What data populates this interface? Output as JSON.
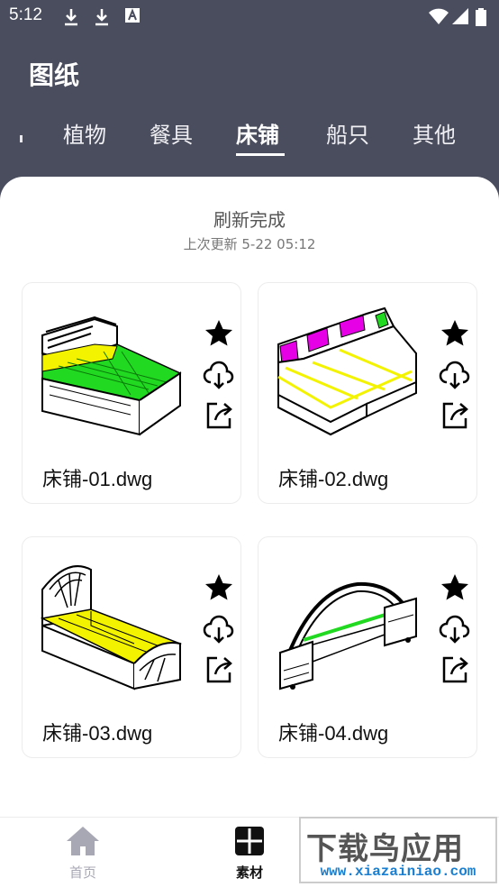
{
  "status": {
    "time": "5:12"
  },
  "app": {
    "title": "图纸"
  },
  "tabs": [
    {
      "label": "植物",
      "active": false
    },
    {
      "label": "餐具",
      "active": false
    },
    {
      "label": "床铺",
      "active": true
    },
    {
      "label": "船只",
      "active": false
    },
    {
      "label": "其他",
      "active": false
    }
  ],
  "refresh": {
    "title": "刷新完成",
    "subtitle": "上次更新 5-22 05:12"
  },
  "cards": [
    {
      "name": "床铺-01.dwg"
    },
    {
      "name": "床铺-02.dwg"
    },
    {
      "name": "床铺-03.dwg"
    },
    {
      "name": "床铺-04.dwg"
    }
  ],
  "nav": {
    "home": {
      "label": "首页"
    },
    "material": {
      "label": "素材"
    }
  },
  "watermark": {
    "big": "下载鸟应用",
    "small": "www.xiazainiao.com"
  },
  "colors": {
    "header": "#4a4d5d",
    "accent": "#111111",
    "nav_inactive": "#a8a8b4"
  }
}
